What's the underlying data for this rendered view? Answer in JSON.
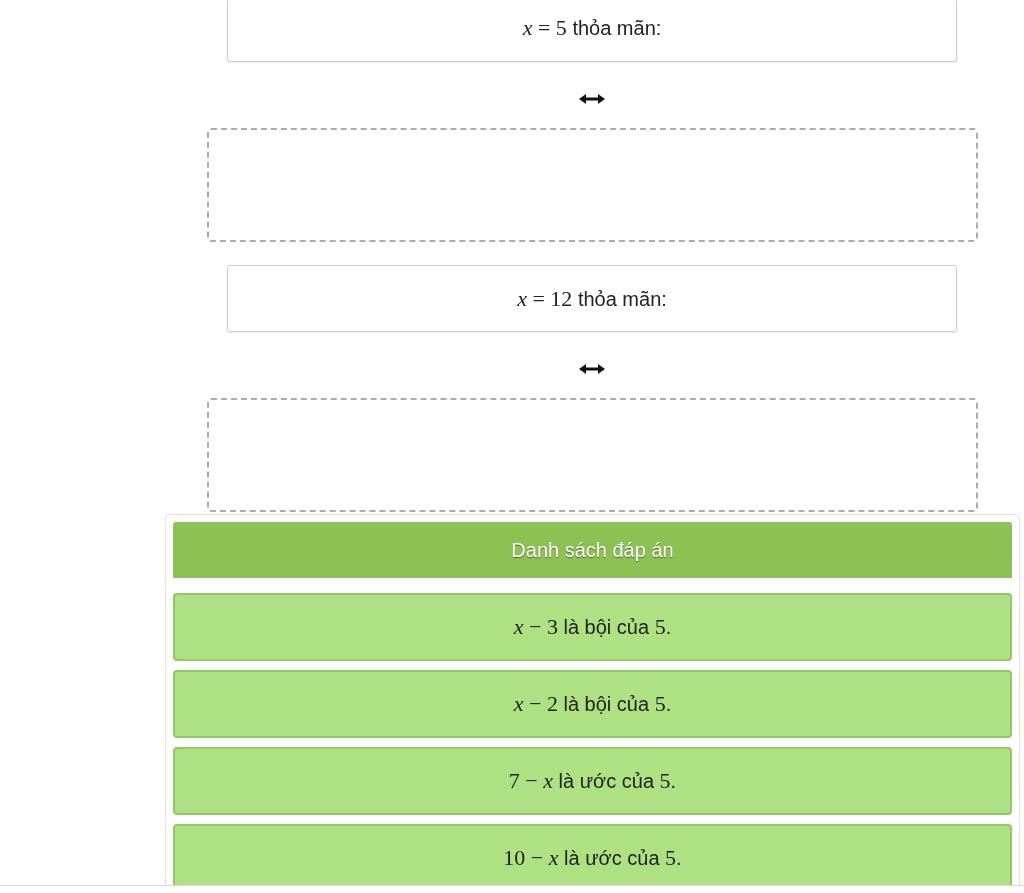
{
  "matching": [
    {
      "prompt": [
        {
          "kind": "math",
          "text": "*x* = 5"
        },
        {
          "kind": "text",
          "text": " thỏa mãn:"
        }
      ]
    },
    {
      "prompt": [
        {
          "kind": "math",
          "text": "*x* = 12"
        },
        {
          "kind": "text",
          "text": " thỏa mãn:"
        }
      ]
    }
  ],
  "answer_panel": {
    "title": "Danh sách đáp án",
    "answers": [
      {
        "parts": [
          {
            "kind": "math",
            "text": "*x* − 3"
          },
          {
            "kind": "text",
            "text": " là bội của "
          },
          {
            "kind": "math",
            "text": "5"
          },
          {
            "kind": "text",
            "text": "."
          }
        ]
      },
      {
        "parts": [
          {
            "kind": "math",
            "text": "*x* − 2"
          },
          {
            "kind": "text",
            "text": " là bội của "
          },
          {
            "kind": "math",
            "text": "5"
          },
          {
            "kind": "text",
            "text": "."
          }
        ]
      },
      {
        "parts": [
          {
            "kind": "math",
            "text": "7 − *x*"
          },
          {
            "kind": "text",
            "text": " là ước của "
          },
          {
            "kind": "math",
            "text": "5"
          },
          {
            "kind": "text",
            "text": "."
          }
        ]
      },
      {
        "parts": [
          {
            "kind": "math",
            "text": "10 − *x*"
          },
          {
            "kind": "text",
            "text": " là ước của "
          },
          {
            "kind": "math",
            "text": "5"
          },
          {
            "kind": "text",
            "text": "."
          }
        ]
      }
    ]
  }
}
